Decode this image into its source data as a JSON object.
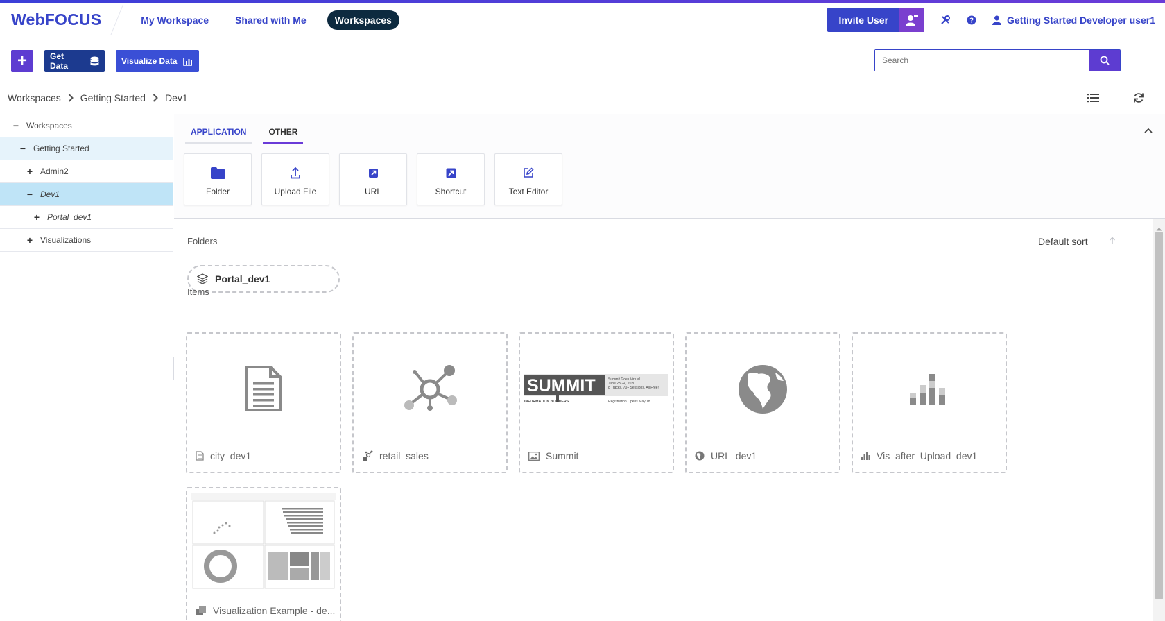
{
  "app": {
    "logo": "WebFOCUS"
  },
  "nav": {
    "my_workspace": "My Workspace",
    "shared": "Shared with Me",
    "workspaces": "Workspaces"
  },
  "header": {
    "invite_label": "Invite User",
    "user_name": "Getting Started Developer user1"
  },
  "toolbar": {
    "get_data": "Get Data",
    "visualize_data": "Visualize Data",
    "search_placeholder": "Search"
  },
  "breadcrumb": [
    "Workspaces",
    "Getting Started",
    "Dev1"
  ],
  "tree": [
    {
      "toggle": "−",
      "label": "Workspaces"
    },
    {
      "toggle": "−",
      "label": "Getting Started"
    },
    {
      "toggle": "+",
      "label": "Admin2"
    },
    {
      "toggle": "−",
      "label": "Dev1"
    },
    {
      "toggle": "+",
      "label": "Portal_dev1"
    },
    {
      "toggle": "+",
      "label": "Visualizations"
    }
  ],
  "tabs": {
    "application": "APPLICATION",
    "other": "OTHER"
  },
  "tiles": [
    "Folder",
    "Upload File",
    "URL",
    "Shortcut",
    "Text Editor"
  ],
  "content": {
    "folders_label": "Folders",
    "items_label": "Items",
    "sort_label": "Default sort",
    "folder": "Portal_dev1",
    "items": [
      "city_dev1",
      "retail_sales",
      "Summit",
      "URL_dev1",
      "Vis_after_Upload_dev1",
      "Visualization Example - de..."
    ]
  },
  "summit": {
    "brand": "SUMMIT",
    "sub": "INFORMATION BUILDERS",
    "line1": "Summit Goes Virtual",
    "line2": "June 23-24, 2020",
    "line3": "8 Tracks, 70+ Sessions, All Free!",
    "line4": "Registration Opens May 18"
  },
  "colors": {
    "brand": "#3744c9",
    "accent": "#5d3cd1",
    "dark_nav": "#0d2a3f",
    "selection": "#bfe4f7"
  }
}
